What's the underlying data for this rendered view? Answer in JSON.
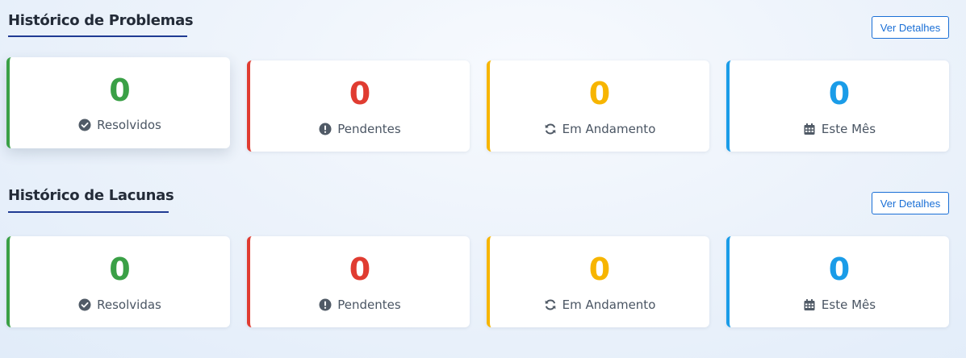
{
  "problems": {
    "title": "Histórico de Problemas",
    "details_label": "Ver Detalhes",
    "cards": [
      {
        "value": "0",
        "label": "Resolvidos",
        "icon": "check-circle-icon",
        "color": "#3aa046"
      },
      {
        "value": "0",
        "label": "Pendentes",
        "icon": "exclamation-circle-icon",
        "color": "#e03c31"
      },
      {
        "value": "0",
        "label": "Em Andamento",
        "icon": "sync-icon",
        "color": "#f7b500"
      },
      {
        "value": "0",
        "label": "Este Mês",
        "icon": "calendar-icon",
        "color": "#1a9ce8"
      }
    ]
  },
  "gaps": {
    "title": "Histórico de Lacunas",
    "details_label": "Ver Detalhes",
    "cards": [
      {
        "value": "0",
        "label": "Resolvidas",
        "icon": "check-circle-icon",
        "color": "#3aa046"
      },
      {
        "value": "0",
        "label": "Pendentes",
        "icon": "exclamation-circle-icon",
        "color": "#e03c31"
      },
      {
        "value": "0",
        "label": "Em Andamento",
        "icon": "sync-icon",
        "color": "#f7b500"
      },
      {
        "value": "0",
        "label": "Este Mês",
        "icon": "calendar-icon",
        "color": "#1a9ce8"
      }
    ]
  }
}
